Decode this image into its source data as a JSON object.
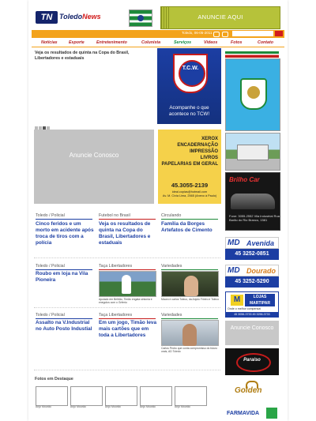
{
  "header": {
    "logo_mark": "TN",
    "logo_word_left": "Toledo",
    "logo_word_right": "News",
    "top_ad": "ANUNCIE AQUI"
  },
  "topbar": {
    "date": "Toledo, 06-05-2011",
    "search_placeholder": ""
  },
  "nav": {
    "items": [
      {
        "label": "Notícias"
      },
      {
        "label": "Esporte"
      },
      {
        "label": "Entretenimento"
      },
      {
        "label": "Colunista"
      },
      {
        "label": "Serviços"
      },
      {
        "label": "Vídeos"
      },
      {
        "label": "Fotos"
      },
      {
        "label": "Contato"
      }
    ]
  },
  "slideshow": {
    "caption": "Veja os resultados de quinta na Copa do Brasil, Libertadores e estaduais"
  },
  "tcw_ad": {
    "badge": "T.C.W.",
    "text": "Acompanhe o que acontece no TCW!"
  },
  "mid": {
    "anuncie": "Anuncie Conosco",
    "xerox_lines": [
      "XEROX",
      "ENCADERNAÇÃO",
      "IMPRESSÃO",
      "LIVROS",
      "PAPELARIAS EM GERAL"
    ],
    "xerox_phone": "45.3055-2139",
    "xerox_email": "ideal.copias@hotmail.com",
    "xerox_address": "Av. M. Cívia Lima, 2565 (Anexo à Paulo)"
  },
  "news": {
    "row1": [
      {
        "category": "Toledo / Policial",
        "title": "Cinco feridos e um morto em acidente após troca de tiros com a polícia"
      },
      {
        "category": "Futebol no Brasil",
        "title": "Veja os resultados de quinta na Copa do Brasil, Libertadores e estaduais"
      },
      {
        "category": "Circulando",
        "title": "Família da Borges Artefatos de Cimento"
      }
    ],
    "row2": [
      {
        "category": "Toledo / Policial",
        "title": "Roubo em loja na Vila Pioneira"
      },
      {
        "category": "Taça Libertadores",
        "caption": "Apoiado em Beltrão, Timão engata sintonia e enegolos com o Grêmio"
      },
      {
        "category": "Variedades",
        "caption": "Mauro e carlos Toleco, da Anjolo Frieiro e Toleco"
      }
    ],
    "row3": [
      {
        "category": "Toledo / Policial",
        "title": "Assalto na V.Industrial no Auto Posto Industial"
      },
      {
        "category": "Taça Libertadores",
        "title": "Em um jogo, Timão leva mais cartões que em toda a Libertadores"
      },
      {
        "category": "Variedades",
        "caption": "Carlos Pedro que conta compromisso do futuro orais, AD Toledo"
      }
    ]
  },
  "sidebar": {
    "brilho_title": "Brilho Car",
    "brilho_sub": "Fone: 3055-2552 Vila Industrial Rua Barão do Rio Branco, 1581",
    "md_logo": "MD",
    "md1_name": "Avenida",
    "md1_phone": "45 3252-0851",
    "md2_name": "Dourado",
    "md2_phone": "45 3252-5290",
    "lojas_mark": "M",
    "lojas_name": "LOJAS MARTIPAR",
    "lojas_slogan": "Onde o melhor compensa!",
    "lojas_phones": "45 3056-3733  45 3256-3733",
    "anuncie": "Anuncie Conosco",
    "black_ad": "Paraíso",
    "golden": "Golden",
    "farma": "FARMAVIDA"
  },
  "fotos": {
    "title": "Fotos em Destaque",
    "captions": [
      "Anjo Mourão",
      "Anjo Mourão",
      "Anjo Mourão",
      "Anjo Mourão",
      "Anjo Mourão"
    ]
  }
}
